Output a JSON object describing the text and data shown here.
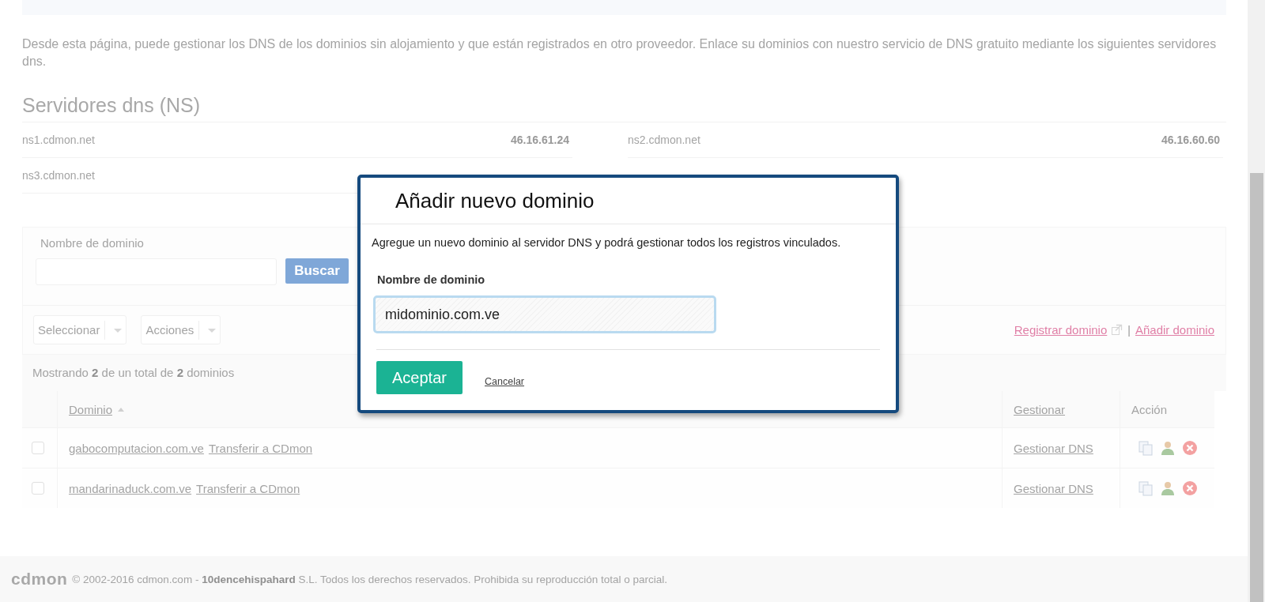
{
  "intro": "Desde esta página, puede gestionar los DNS de los dominios sin alojamiento y que están registrados en otro proveedor. Enlace su dominios con nuestro servicio de DNS gratuito mediante los siguientes servidores dns.",
  "ns_section": {
    "title": "Servidores dns (NS)",
    "servers": [
      {
        "name": "ns1.cdmon.net",
        "ip": "46.16.61.24"
      },
      {
        "name": "ns2.cdmon.net",
        "ip": "46.16.60.60"
      },
      {
        "name": "ns3.cdmon.net"
      }
    ]
  },
  "search": {
    "label": "Nombre de dominio",
    "button": "Buscar"
  },
  "toolbar": {
    "dropdowns": [
      "Seleccionar",
      "Acciones"
    ],
    "separator": "|",
    "links": [
      {
        "label": "Registrar dominio",
        "external": true
      },
      {
        "label": "Añadir dominio",
        "external": false
      }
    ]
  },
  "summary": "Mostrando **2** de un total de **2** dominios",
  "table": {
    "columns": [
      {
        "label": "Dominio",
        "sorted": true
      },
      {
        "label": "Gestionar",
        "sorted": false
      },
      {
        "label": "Acción",
        "sorted": false
      }
    ],
    "rows": [
      {
        "checked": false,
        "domain": "gabocomputacion.com.ve",
        "transfer": "Transferir a CDmon",
        "manage": "Gestionar DNS"
      },
      {
        "checked": false,
        "domain": "mandarinaduck.com.ve",
        "transfer": "Transferir a CDmon",
        "manage": "Gestionar DNS"
      }
    ]
  },
  "footer": {
    "logo": "cdmon",
    "text": "© 2002-2016 cdmon.com - **10dencehispahard** S.L. Todos los derechos reservados. Prohibida su reproducción total o parcial."
  },
  "dialog": {
    "title": "Añadir nuevo dominio",
    "description": "Agregue un nuevo dominio al servidor DNS y podrá gestionar todos los registros vinculados.",
    "field": {
      "label": "Nombre de dominio",
      "value": "midominio.com.ve"
    },
    "buttons": [
      {
        "label": "Aceptar",
        "kind": "primary"
      },
      {
        "label": "Cancelar",
        "kind": "link"
      }
    ]
  }
}
